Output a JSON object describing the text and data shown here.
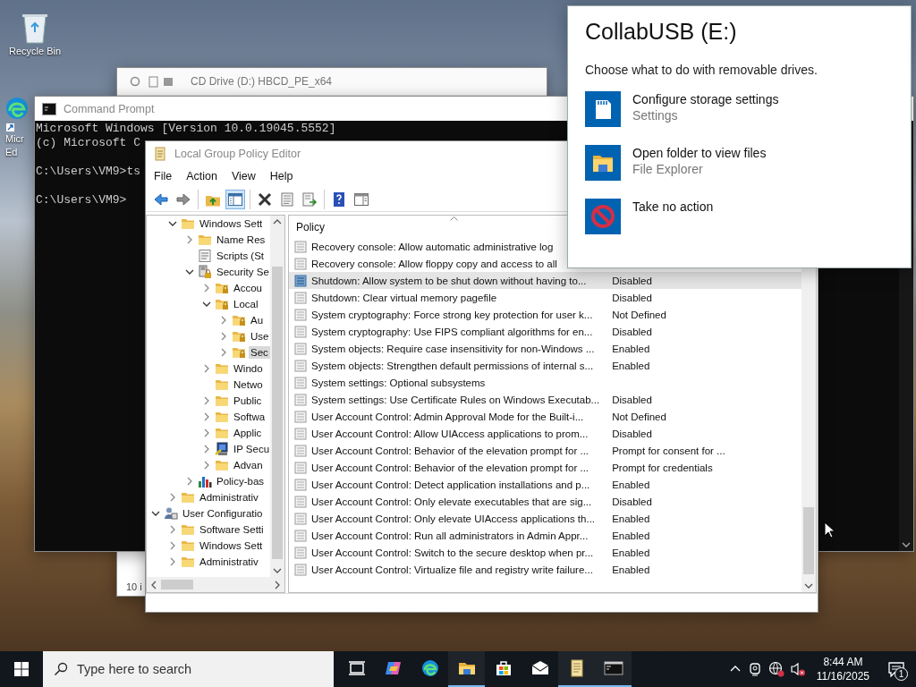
{
  "desktop": {
    "icons": [
      {
        "kind": "recycle-bin",
        "lines": [
          "Recycle Bin"
        ]
      },
      {
        "kind": "edge",
        "lines": [
          "Micr",
          "Ed"
        ]
      }
    ]
  },
  "background_window": {
    "title": "CD Drive (D:) HBCD_PE_x64",
    "status": "10 i"
  },
  "command_prompt": {
    "title": "Command Prompt",
    "blocks": [
      [
        "Microsoft Windows [Version 10.0.19045.5552]",
        "(c) Microsoft C"
      ],
      [
        "C:\\Users\\VM9>ts"
      ],
      [
        "C:\\Users\\VM9>"
      ]
    ]
  },
  "policy_editor": {
    "title": "Local Group Policy Editor",
    "menu": [
      "File",
      "Action",
      "View",
      "Help"
    ],
    "toolbar": [
      [
        {
          "kind": "back",
          "pressed": false
        },
        {
          "kind": "forward",
          "pressed": false
        }
      ],
      [
        {
          "kind": "up",
          "pressed": false
        },
        {
          "kind": "tree",
          "pressed": true
        }
      ],
      [
        {
          "kind": "delete",
          "pressed": false
        },
        {
          "kind": "properties",
          "pressed": false
        },
        {
          "kind": "export",
          "pressed": false
        }
      ],
      [
        {
          "kind": "help",
          "pressed": false
        },
        {
          "kind": "view",
          "pressed": false
        }
      ]
    ],
    "tree": {
      "upper_items": [
        {
          "label": "Windows Sett",
          "kind": "folder",
          "expanded": true,
          "selected": false,
          "children": [
            {
              "label": "Name Res",
              "kind": "folder",
              "expanded": false,
              "selected": false
            },
            {
              "label": "Scripts (St",
              "kind": "script",
              "selected": false
            },
            {
              "label": "Security Se",
              "kind": "security",
              "expanded": true,
              "selected": false,
              "children": [
                {
                  "label": "Accou",
                  "kind": "locked-folder",
                  "expanded": false,
                  "selected": false
                },
                {
                  "label": "Local",
                  "kind": "locked-folder",
                  "expanded": true,
                  "selected": false,
                  "children": [
                    {
                      "label": "Au",
                      "kind": "locked-folder",
                      "expanded": false,
                      "selected": false
                    },
                    {
                      "label": "Use",
                      "kind": "locked-folder",
                      "expanded": false,
                      "selected": false
                    },
                    {
                      "label": "Sec",
                      "kind": "locked-folder",
                      "expanded": false,
                      "selected": true
                    }
                  ]
                },
                {
                  "label": "Windo",
                  "kind": "folder",
                  "expanded": false,
                  "selected": false
                },
                {
                  "label": "Netwo",
                  "kind": "folder",
                  "selected": false
                },
                {
                  "label": "Public",
                  "kind": "folder",
                  "expanded": false,
                  "selected": false
                },
                {
                  "label": "Softwa",
                  "kind": "folder",
                  "expanded": false,
                  "selected": false
                },
                {
                  "label": "Applic",
                  "kind": "folder",
                  "expanded": false,
                  "selected": false
                },
                {
                  "label": "IP Secu",
                  "kind": "ip-security",
                  "expanded": false,
                  "selected": false
                },
                {
                  "label": "Advan",
                  "kind": "folder",
                  "expanded": false,
                  "selected": false
                }
              ]
            },
            {
              "label": "Policy-bas",
              "kind": "chart",
              "expanded": false,
              "selected": false
            }
          ]
        },
        {
          "label": "Administrativ",
          "kind": "folder",
          "expanded": false,
          "selected": false
        }
      ],
      "items": [
        {
          "label": "User Configuratio",
          "kind": "user",
          "expanded": true,
          "selected": false,
          "children": [
            {
              "label": "Software Setti",
              "kind": "folder",
              "expanded": false,
              "selected": false
            },
            {
              "label": "Windows Sett",
              "kind": "folder",
              "expanded": false,
              "selected": false
            },
            {
              "label": "Administrativ",
              "kind": "folder",
              "expanded": false,
              "selected": false
            }
          ]
        }
      ]
    },
    "table": {
      "columns": [
        "Policy"
      ],
      "rows": [
        {
          "name": "Recovery console: Allow automatic administrative log",
          "selected": false
        },
        {
          "name": "Recovery console: Allow floppy copy and access to all",
          "selected": false
        },
        {
          "name": "Shutdown: Allow system to be shut down without having to...",
          "setting": "Disabled",
          "selected": true
        },
        {
          "name": "Shutdown: Clear virtual memory pagefile",
          "setting": "Disabled",
          "selected": false
        },
        {
          "name": "System cryptography: Force strong key protection for user k...",
          "setting": "Not Defined",
          "selected": false
        },
        {
          "name": "System cryptography: Use FIPS compliant algorithms for en...",
          "setting": "Disabled",
          "selected": false
        },
        {
          "name": "System objects: Require case insensitivity for non-Windows ...",
          "setting": "Enabled",
          "selected": false
        },
        {
          "name": "System objects: Strengthen default permissions of internal s...",
          "setting": "Enabled",
          "selected": false
        },
        {
          "name": "System settings: Optional subsystems",
          "selected": false
        },
        {
          "name": "System settings: Use Certificate Rules on Windows Executab...",
          "setting": "Disabled",
          "selected": false
        },
        {
          "name": "User Account Control: Admin Approval Mode for the Built-i...",
          "setting": "Not Defined",
          "selected": false
        },
        {
          "name": "User Account Control: Allow UIAccess applications to prom...",
          "setting": "Disabled",
          "selected": false
        },
        {
          "name": "User Account Control: Behavior of the elevation prompt for ...",
          "setting": "Prompt for consent for ...",
          "selected": false
        },
        {
          "name": "User Account Control: Behavior of the elevation prompt for ...",
          "setting": "Prompt for credentials",
          "selected": false
        },
        {
          "name": "User Account Control: Detect application installations and p...",
          "setting": "Enabled",
          "selected": false
        },
        {
          "name": "User Account Control: Only elevate executables that are sig...",
          "setting": "Disabled",
          "selected": false
        },
        {
          "name": "User Account Control: Only elevate UIAccess applications th...",
          "setting": "Enabled",
          "selected": false
        },
        {
          "name": "User Account Control: Run all administrators in Admin Appr...",
          "setting": "Enabled",
          "selected": false
        },
        {
          "name": "User Account Control: Switch to the secure desktop when pr...",
          "setting": "Enabled",
          "selected": false
        },
        {
          "name": "User Account Control: Virtualize file and registry write failure...",
          "setting": "Enabled",
          "selected": false
        }
      ]
    }
  },
  "autoplay_popup": {
    "title": "CollabUSB (E:)",
    "subtitle": "Choose what to do with removable drives.",
    "options": [
      {
        "kind": "sd-card",
        "title": "Configure storage settings",
        "detail": "Settings"
      },
      {
        "kind": "folder",
        "title": "Open folder to view files",
        "detail": "File Explorer"
      },
      {
        "kind": "no-entry",
        "title": "Take no action"
      }
    ]
  },
  "taskbar": {
    "search": {
      "placeholder": "Type here to search"
    },
    "apps": [
      {
        "kind": "task-view",
        "open": false
      },
      {
        "kind": "copilot",
        "open": false
      },
      {
        "kind": "edge",
        "open": false
      },
      {
        "kind": "explorer",
        "open": true
      },
      {
        "kind": "store",
        "open": false
      },
      {
        "kind": "mail",
        "open": false
      },
      {
        "kind": "notepad",
        "open": true
      },
      {
        "kind": "terminal",
        "open": true
      }
    ],
    "time": "8:44 AM",
    "date": "11/16/2025",
    "notifications": "1"
  }
}
